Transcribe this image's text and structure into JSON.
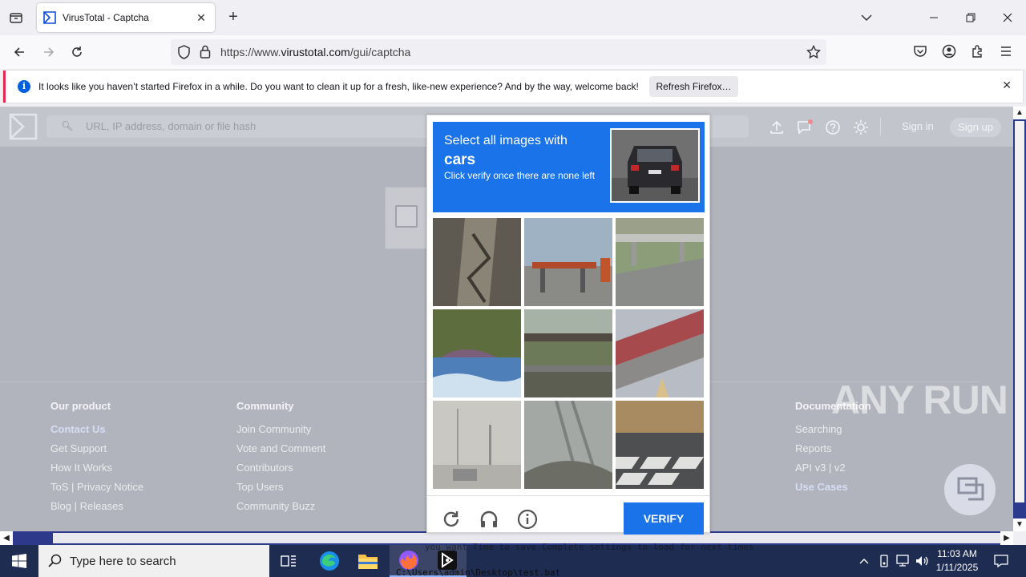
{
  "browser": {
    "tab_title": "VirusTotal - Captcha",
    "url_prefix": "https://www.",
    "url_host": "virustotal.com",
    "url_path": "/gui/captcha"
  },
  "notification": {
    "message": "It looks like you haven’t started Firefox in a while. Do you want to clean it up for a fresh, like-new experience? And by the way, welcome back!",
    "button": "Refresh Firefox…"
  },
  "vt": {
    "search_placeholder": "URL, IP address, domain or file hash",
    "signin": "Sign in",
    "signup": "Sign up"
  },
  "footer": {
    "product": {
      "head": "Our product",
      "links": [
        "Contact Us",
        "Get Support",
        "How It Works",
        "ToS | Privacy Notice",
        "Blog | Releases"
      ]
    },
    "community": {
      "head": "Community",
      "links": [
        "Join Community",
        "Vote and Comment",
        "Contributors",
        "Top Users",
        "Community Buzz"
      ]
    },
    "documentation": {
      "head": "Documentation",
      "links": [
        "Searching",
        "Reports",
        "API v3 | v2",
        "Use Cases"
      ]
    }
  },
  "captcha": {
    "line1": "Select all images with",
    "target": "cars",
    "line3": "Click verify once there are none left",
    "verify": "VERIFY"
  },
  "watermark": "ANY RUN",
  "taskbar": {
    "search_placeholder": "Type here to search",
    "time": "11:03 AM",
    "date": "1/11/2025",
    "cmd_line1": "you want Time to save Complete settings to load for next times",
    "cmd_line2": "C:\\Users\\admin\\Desktop\\test.bat"
  },
  "colors": {
    "accent": "#1a73e8",
    "taskbar": "#1f2c52",
    "page_overlay": "#b2b4bd"
  }
}
